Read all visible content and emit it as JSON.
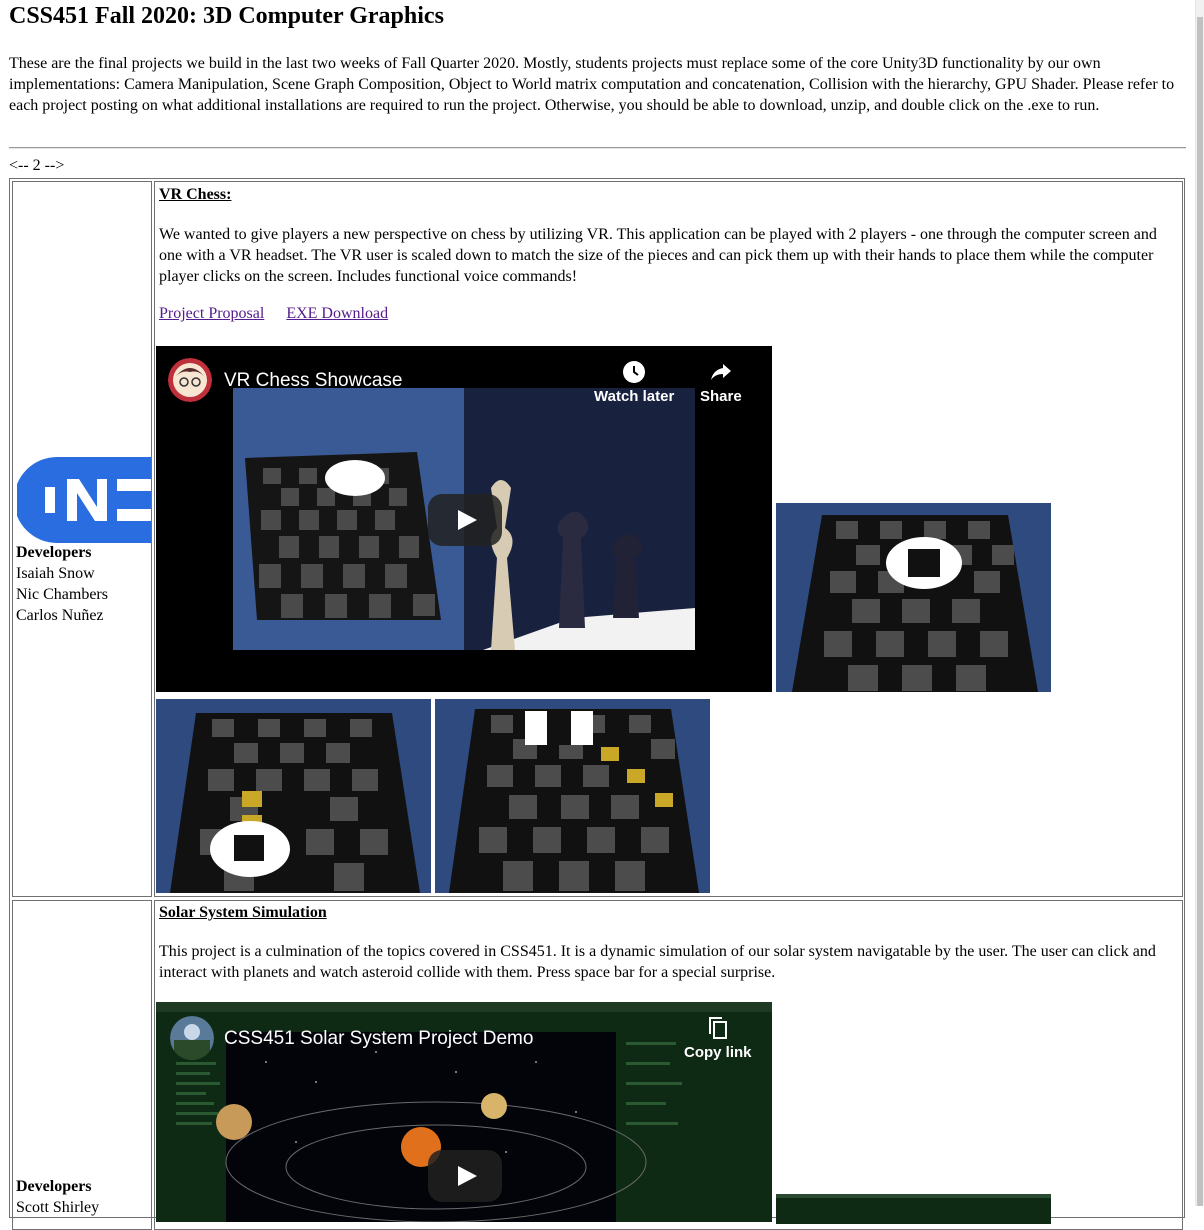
{
  "page": {
    "title": "CSS451 Fall 2020: 3D Computer Graphics",
    "intro": "These are the final projects we build in the last two weeks of Fall Quarter 2020. Mostly, students projects must replace some of the core Unity3D functionality by our own implementations: Camera Manipulation, Scene Graph Composition, Object to World matrix computation and concatenation, Collision with the hierarchy, GPU Shader. Please refer to each project posting on what additional installations are required to run the project. Otherwise, you should be able to download, unzip, and double click on the .exe to run.",
    "pager": "<-- 2 -->"
  },
  "projects": [
    {
      "developers_heading": "Developers",
      "developers": [
        "Isaiah Snow",
        "Nic Chambers",
        "Carlos Nuñez"
      ],
      "title": "VR Chess:",
      "description": "We wanted to give players a new perspective on chess by utilizing VR. This application can be played with 2 players - one through the computer screen and one with a VR headset. The VR user is scaled down to match the size of the pieces and can pick them up with their hands to place them while the computer player clicks on the screen. Includes functional voice commands!",
      "link_proposal": "Project Proposal",
      "link_download": "EXE Download",
      "video": {
        "title": "VR Chess Showcase",
        "watch_later": "Watch later",
        "share": "Share",
        "icons": [
          "clock-icon",
          "share-arrow-icon",
          "play-icon"
        ]
      }
    },
    {
      "developers_heading": "Developers",
      "developers": [
        "Scott Shirley"
      ],
      "title": "Solar System Simulation",
      "description": "This project is a culmination of the topics covered in CSS451. It is a dynamic simulation of our solar system navigatable by the user. The user can click and interact with planets and watch asteroid collide with them. Press space bar for a special surprise.",
      "video": {
        "title": "CSS451 Solar System Project Demo",
        "copy_link": "Copy link",
        "icons": [
          "copy-icon",
          "play-icon"
        ]
      }
    }
  ],
  "colors": {
    "link_visited": "#551a8b",
    "logo_blue": "#2a6de0",
    "board_bg": "#2e4a7e",
    "table_border": "#707070"
  }
}
